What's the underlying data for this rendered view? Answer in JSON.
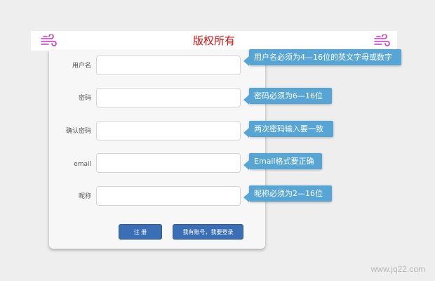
{
  "banner": {
    "title": "版权所有",
    "deco_color": "#cc33cc",
    "left_icon": "wind-icon",
    "right_icon": "wind-icon"
  },
  "form": {
    "fields": [
      {
        "label": "用户名",
        "value": "",
        "tip": "用户名必须为4—16位的英文字母或数字"
      },
      {
        "label": "密码",
        "value": "",
        "tip": "密码必须为6—16位"
      },
      {
        "label": "确认密码",
        "value": "",
        "tip": "两次密码输入要一致"
      },
      {
        "label": "email",
        "value": "",
        "tip": "Email格式要正确"
      },
      {
        "label": "昵称",
        "value": "",
        "tip": "昵称必须为2—16位"
      }
    ],
    "register_label": "注 册",
    "login_label": "我有账号，我要登录"
  },
  "colors": {
    "button": "#3a6fb5",
    "tip": "#57a5d4",
    "title": "#cc1111"
  },
  "watermark": "www.jq22.com"
}
